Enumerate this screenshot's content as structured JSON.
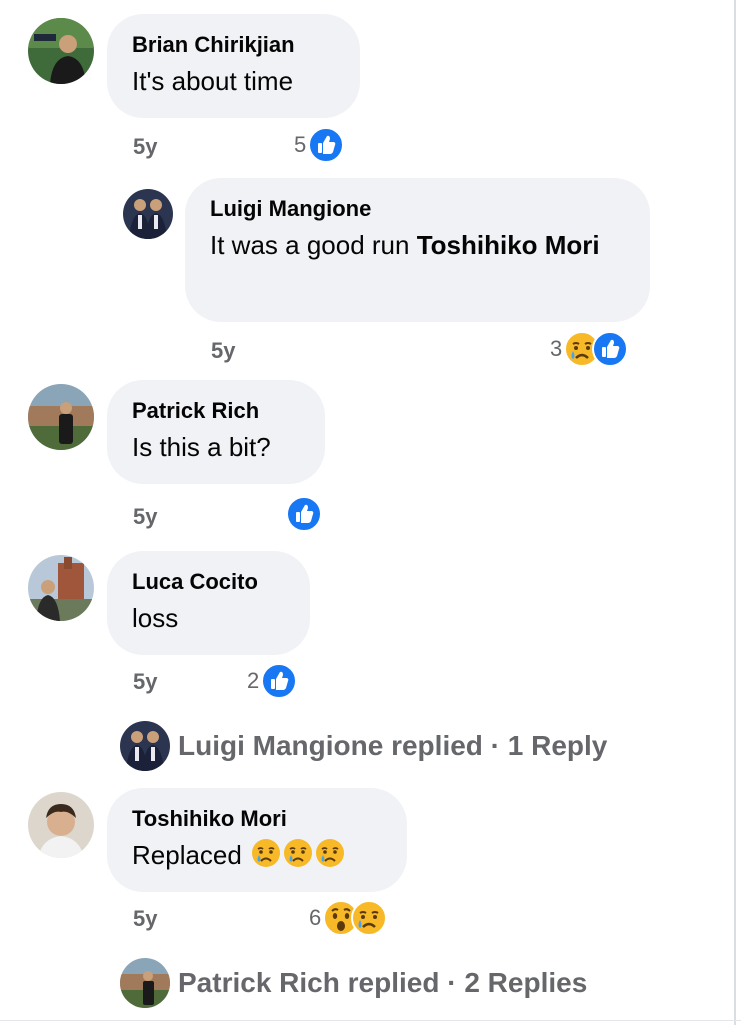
{
  "comments": [
    {
      "author": "Brian Chirikjian",
      "text": "It's about time",
      "age": "5y",
      "reaction_count": "5",
      "reactions": [
        "like-icon"
      ]
    },
    {
      "author": "Luigi Mangione",
      "text": "It was a good run ",
      "mention": "Toshihiko Mori",
      "age": "5y",
      "reaction_count": "3",
      "reactions": [
        "sad-icon",
        "like-icon"
      ]
    },
    {
      "author": "Patrick Rich",
      "text": "Is this a bit?",
      "age": "5y",
      "reaction_count": "",
      "reactions": [
        "like-icon"
      ]
    },
    {
      "author": "Luca Cocito",
      "text": "loss",
      "age": "5y",
      "reaction_count": "2",
      "reactions": [
        "like-icon"
      ],
      "replies_summary": "Luigi Mangione replied · 1 Reply"
    },
    {
      "author": "Toshihiko Mori",
      "text": "Replaced ",
      "emojis": [
        "crying-face",
        "crying-face",
        "crying-face"
      ],
      "age": "5y",
      "reaction_count": "6",
      "reactions": [
        "wow-icon",
        "sad-icon"
      ],
      "replies_summary": "Patrick Rich replied · 2 Replies"
    }
  ],
  "colors": {
    "bubble": "#f0f2f5",
    "meta_text": "#65676b",
    "like_blue": "#1877f2",
    "reaction_yellow": "#f7b928"
  }
}
